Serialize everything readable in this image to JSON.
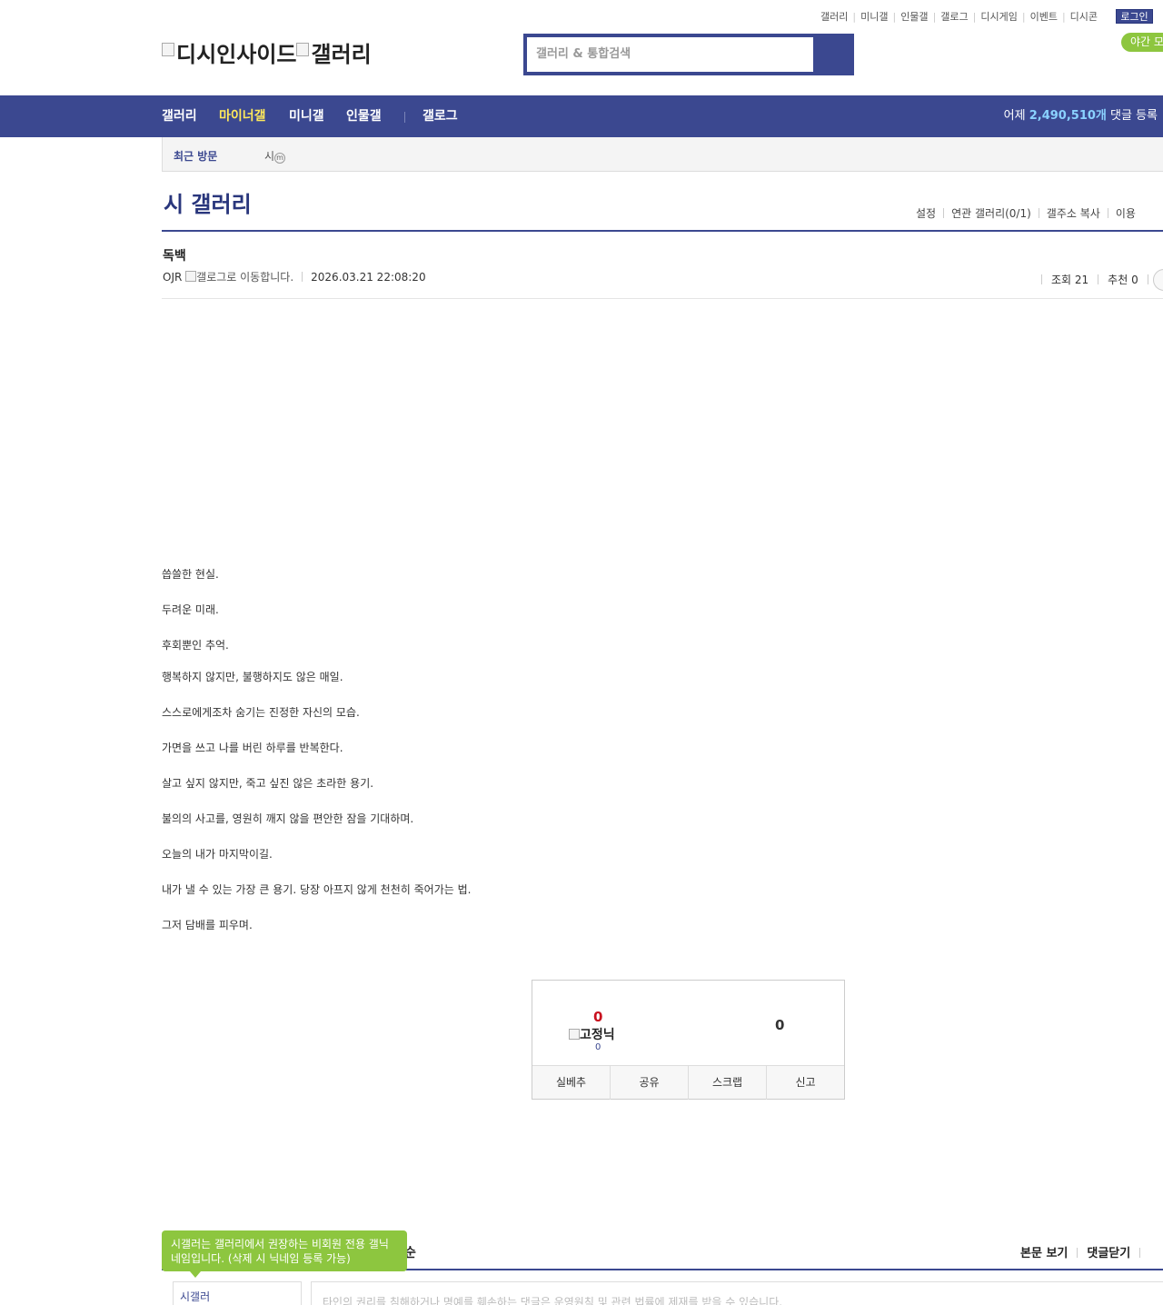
{
  "top_nav": {
    "items": [
      "갤러리",
      "미니갤",
      "인물갤",
      "갤로그",
      "디시게임",
      "이벤트",
      "디시콘"
    ],
    "login": "로그인",
    "night_mode": "야간 모"
  },
  "logo": {
    "site": "디시인사이드",
    "gallery": "갤러리"
  },
  "search": {
    "placeholder": "갤러리 & 통합검색"
  },
  "main_nav": {
    "items": [
      "갤러리",
      "마이너갤",
      "미니갤",
      "인물갤",
      "갤로그"
    ],
    "stat_prefix": "어제",
    "stat_count": "2,490,510개",
    "stat_suffix": "댓글 등록"
  },
  "recent": {
    "label": "최근 방문",
    "item": "시",
    "badge": "m"
  },
  "gallery": {
    "title": "시 갤러리",
    "menu": [
      "설정",
      "연관 갤러리(0/1)",
      "갤주소 복사",
      "이용"
    ]
  },
  "post": {
    "title": "독백",
    "author": "OJR",
    "gallog_alt": "갤로그로 이동합니다.",
    "date": "2026.03.21 22:08:20",
    "views_label": "조회 21",
    "recommend_label": "추천 0",
    "body": [
      "씁쓸한 현실.",
      "두려운 미래.",
      "후회뿐인 추억.",
      "행복하지 않지만, 불행하지도 않은 매일.",
      "스스로에게조차 숨기는 진정한 자신의 모습.",
      "가면을 쓰고 나를 버린 하루를 반복한다.",
      "살고 싶지 않지만, 죽고 싶진 않은 초라한 용기.",
      "불의의 사고를, 영원히 깨지 않을 편안한 잠을 기대하며.",
      "오늘의 내가 마지막이길.",
      "내가 낼 수 있는 가장 큰 용기. 당장 아프지 않게 천천히 죽어가는 법.",
      "그저 담배를 피우며."
    ]
  },
  "recommend_box": {
    "up_count": "0",
    "fixed_nick_alt": "고정닉",
    "fixed_nick_count": "0",
    "down_count": "0",
    "buttons": [
      "실베추",
      "공유",
      "스크랩",
      "신고"
    ]
  },
  "comments": {
    "tooltip": "시갤러는 갤러리에서 권장하는 비회원 전용 갤닉네임입니다. (삭제 시 닉네임 등록 가능)",
    "partial_title": "순",
    "links": [
      "본문 보기",
      "댓글닫기"
    ],
    "nick": "시갤러",
    "input_notice": "타인의 권리를 침해하거나 명예를 훼손하는 댓글은 운영원칙 및 관련 법률에 제재를 받을 수 있습니다."
  },
  "colors": {
    "brand": "#3b4890",
    "accent_yellow": "#ffe95b",
    "tooltip_green": "#8dc63f",
    "recommend_red": "#c8101e"
  }
}
